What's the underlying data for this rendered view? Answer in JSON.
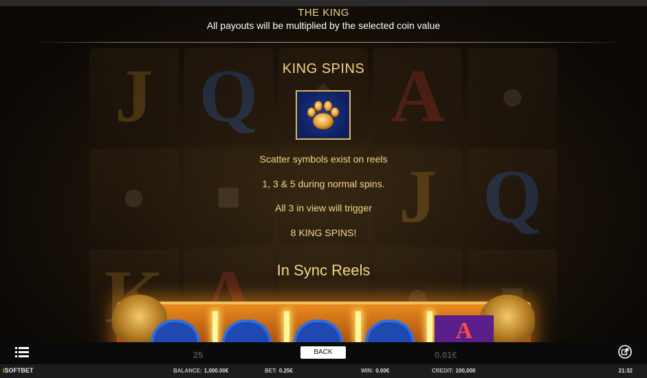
{
  "header": {
    "title": "THE KING",
    "subtitle": "All payouts will be multiplied by the selected coin value"
  },
  "feature": {
    "title": "KING SPINS",
    "symbol_icon": "paw-print-icon",
    "lines": [
      "Scatter symbols exist on reels",
      "1, 3 & 5 during normal spins.",
      "All 3 in view will trigger",
      "8 KING SPINS!"
    ]
  },
  "next_section": {
    "title": "In Sync Reels"
  },
  "background": {
    "reel_letters": [
      "J",
      "Q",
      "A",
      "A",
      "K"
    ],
    "shaded_numbers": [
      "25",
      "0.01€"
    ],
    "mini_reel_letter": "A"
  },
  "controls": {
    "back_label": "BACK",
    "menu_icon": "list-menu-icon",
    "external_icon": "external-link-icon"
  },
  "status": {
    "brand_prefix": "i",
    "brand_main": "SOFTBET",
    "balance_label": "BALANCE:",
    "balance_value": "1,000.00€",
    "bet_label": "BET:",
    "bet_value": "0.25€",
    "win_label": "WIN:",
    "win_value": "0.00€",
    "credit_label": "CREDIT:",
    "credit_value": "100,000",
    "time": "21:32"
  },
  "colors": {
    "gold_text": "#f3d68a",
    "white_text": "#ffffff",
    "scatter_bg": "#0e1f5c",
    "frame_orange": "#e98a1e"
  }
}
